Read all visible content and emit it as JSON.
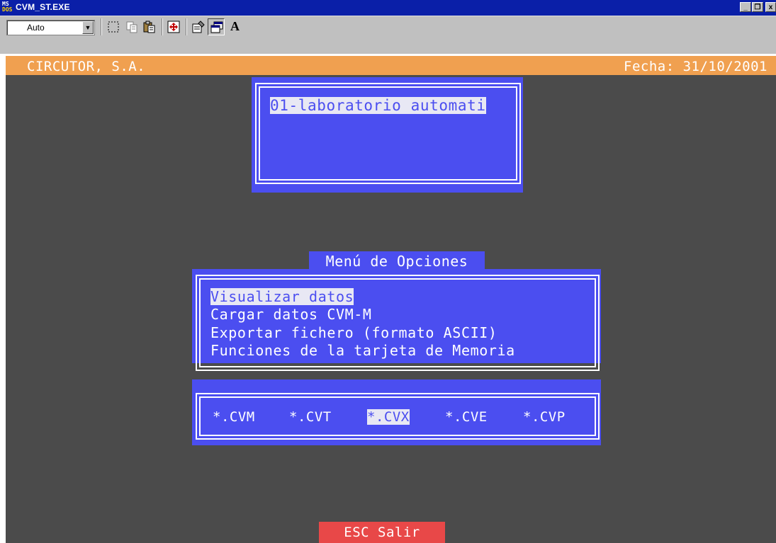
{
  "window": {
    "title": "CVM_ST.EXE",
    "icon_ms": "MS",
    "icon_dos": "DOS",
    "minimize_glyph": "_",
    "restore_glyph": "❐",
    "close_glyph": "x"
  },
  "toolbar": {
    "font_size_value": "Auto",
    "dropdown_glyph": "▼",
    "buttons": [
      "mark-icon",
      "copy-icon",
      "paste-icon",
      "fullscreen-icon",
      "properties-icon",
      "background-icon",
      "font-icon"
    ],
    "font_button_label": "A"
  },
  "screen": {
    "company": "CIRCUTOR, S.A.",
    "date_text": "Fecha: 31/10/2001",
    "company_list": [
      "01-laboratorio automati"
    ],
    "menu_title": "Menú de Opciones",
    "menu_items": [
      "Visualizar datos",
      "Cargar datos CVM-M",
      "Exportar fichero (formato ASCII)",
      "Funciones de la tarjeta de Memoria"
    ],
    "selected_menu_index": 0,
    "file_types": [
      "*.CVM",
      "*.CVT",
      "*.CVX",
      "*.CVE",
      "*.CVP"
    ],
    "selected_file_type_index": 2,
    "footer": "ESC Salir"
  },
  "colors": {
    "title_bar": "#0a1fa8",
    "toolbar": "#c0c0c0",
    "screen_bg": "#4b4b4b",
    "header_bar": "#f0a050",
    "panel": "#4b4ef0",
    "highlight": "#e8e8f4",
    "footer": "#e84848"
  }
}
